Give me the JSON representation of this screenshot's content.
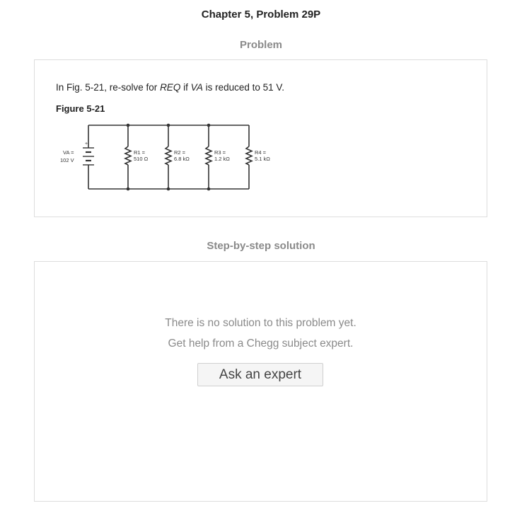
{
  "header": {
    "title": "Chapter 5, Problem 29P"
  },
  "problem": {
    "heading": "Problem",
    "text_parts": [
      "In Fig. 5-21, re-solve for ",
      "REQ",
      " if ",
      "VA",
      " is reduced to 51 V."
    ],
    "figure_label": "Figure 5-21",
    "figure": {
      "source_label": "VA =",
      "source_value": "102 V",
      "resistors": [
        {
          "label": "R1 =",
          "value": "510 Ω"
        },
        {
          "label": "R2 =",
          "value": "6.8 kΩ"
        },
        {
          "label": "R3 =",
          "value": "1.2 kΩ"
        },
        {
          "label": "R4 =",
          "value": "5.1 kΩ"
        }
      ]
    }
  },
  "solution": {
    "heading": "Step-by-step solution",
    "empty_line1": "There is no solution to this problem yet.",
    "empty_line2": "Get help from a Chegg subject expert.",
    "ask_button_label": "Ask an expert"
  },
  "colors": {
    "heading_gray": "#8a8a8a",
    "border": "#dddddd",
    "button_bg": "#f5f5f5"
  }
}
